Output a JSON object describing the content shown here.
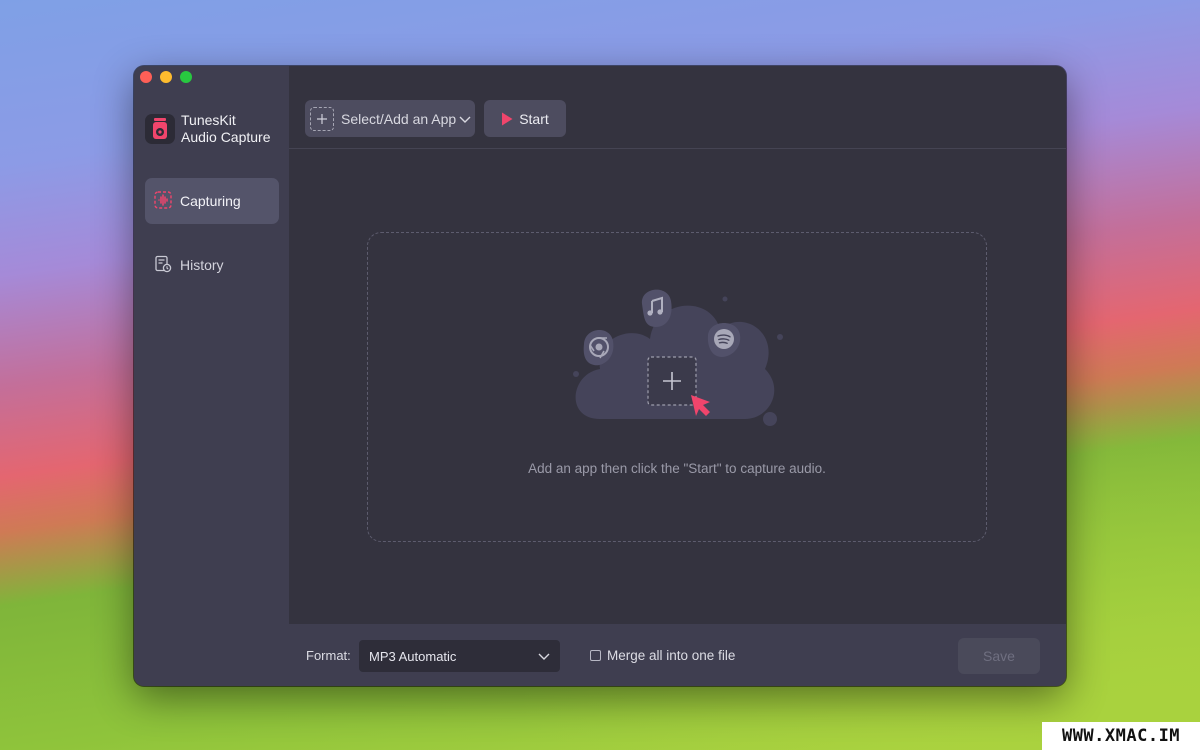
{
  "app": {
    "name_line1": "TunesKit",
    "name_line2": "Audio Capture"
  },
  "sidebar": {
    "items": [
      {
        "label": "Capturing",
        "icon": "waveform-icon",
        "active": true
      },
      {
        "label": "History",
        "icon": "history-icon",
        "active": false
      }
    ]
  },
  "toolbar": {
    "select_label": "Select/Add an App",
    "start_label": "Start"
  },
  "dropzone": {
    "hint": "Add an app then click the \"Start\" to capture audio.",
    "icons": [
      "music-note-icon",
      "chrome-icon",
      "spotify-icon",
      "add-app-icon",
      "cursor-icon"
    ]
  },
  "footer": {
    "format_label": "Format:",
    "format_value": "MP3 Automatic",
    "merge_label": "Merge all into one file",
    "merge_checked": false,
    "save_label": "Save"
  },
  "watermark": "WWW.XMAC.IM",
  "colors": {
    "accent": "#f0456c",
    "sidebar_bg": "#3f3e50",
    "main_bg": "#34333f"
  }
}
